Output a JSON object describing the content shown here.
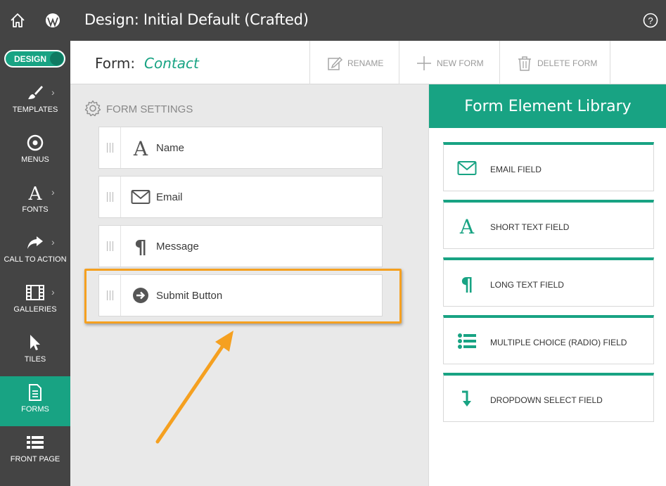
{
  "window": {
    "title": "Design: Initial Default (Crafted)"
  },
  "sidebar": {
    "toggle_label": "DESIGN",
    "items": [
      {
        "label": "TEMPLATES",
        "icon": "brush-icon",
        "has_chevron": true
      },
      {
        "label": "MENUS",
        "icon": "compass-icon",
        "has_chevron": false
      },
      {
        "label": "FONTS",
        "icon": "font-icon",
        "has_chevron": true
      },
      {
        "label": "CALL TO ACTION",
        "icon": "share-arrow-icon",
        "has_chevron": true
      },
      {
        "label": "GALLERIES",
        "icon": "film-icon",
        "has_chevron": true
      },
      {
        "label": "TILES",
        "icon": "cursor-icon",
        "has_chevron": false
      },
      {
        "label": "FORMS",
        "icon": "document-icon",
        "has_chevron": false,
        "active": true
      },
      {
        "label": "FRONT PAGE",
        "icon": "list-icon",
        "has_chevron": false
      }
    ],
    "chevron": "›"
  },
  "formbar": {
    "form_label": "Form:",
    "form_name": "Contact",
    "rename": "RENAME",
    "new_form": "NEW FORM",
    "delete_form": "DELETE FORM"
  },
  "settings": {
    "header": "FORM SETTINGS",
    "fields": [
      {
        "label": "Name",
        "icon": "font-icon"
      },
      {
        "label": "Email",
        "icon": "envelope-icon"
      },
      {
        "label": "Message",
        "icon": "paragraph-icon"
      },
      {
        "label": "Submit Button",
        "icon": "arrow-circle-icon"
      }
    ]
  },
  "library": {
    "title": "Form Element Library",
    "items": [
      {
        "label": "EMAIL FIELD",
        "icon": "envelope-icon"
      },
      {
        "label": "SHORT TEXT FIELD",
        "icon": "font-icon"
      },
      {
        "label": "LONG TEXT FIELD",
        "icon": "paragraph-icon"
      },
      {
        "label": "MULTIPLE CHOICE (RADIO) FIELD",
        "icon": "list-bullets-icon"
      },
      {
        "label": "DROPDOWN SELECT FIELD",
        "icon": "arrow-down-icon"
      }
    ]
  },
  "colors": {
    "accent": "#18a383",
    "dark": "#444444",
    "highlight": "#f5a020"
  }
}
